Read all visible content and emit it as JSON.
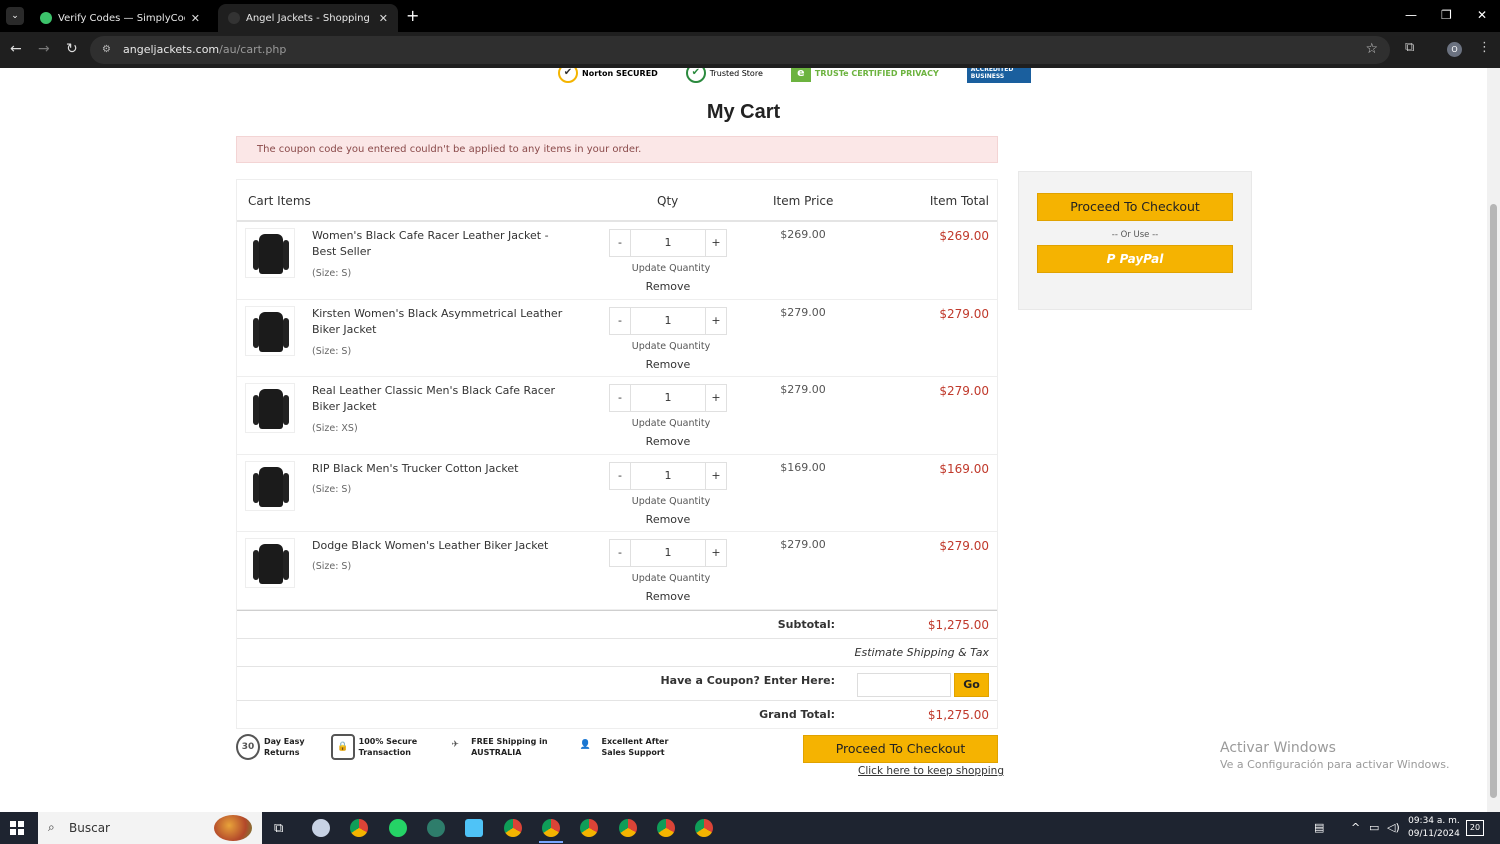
{
  "browser": {
    "tabs": [
      {
        "title": "Verify Codes — SimplyCodes",
        "close": "✕"
      },
      {
        "title": "Angel Jackets - Shopping Cart |",
        "close": "✕"
      }
    ],
    "new_tab": "+",
    "url_host": "angeljackets.com",
    "url_path": "/au/cart.php",
    "profile_initial": "O"
  },
  "badges": {
    "norton": "Norton SECURED",
    "trusted_store": "Trusted Store",
    "truste": "TRUSTe CERTIFIED PRIVACY",
    "bbb": "ACCREDITED BUSINESS"
  },
  "page": {
    "title": "My Cart",
    "alert": "The coupon code you entered couldn't be applied to any items in your order."
  },
  "cart": {
    "headers": {
      "items": "Cart Items",
      "qty": "Qty",
      "price": "Item Price",
      "total": "Item Total"
    },
    "minus": "-",
    "plus": "+",
    "update_label": "Update Quantity",
    "remove_label": "Remove",
    "items": [
      {
        "name": "Women's Black Cafe Racer Leather Jacket - Best Seller",
        "size": "(Size: S)",
        "qty": "1",
        "price": "$269.00",
        "total": "$269.00"
      },
      {
        "name": "Kirsten Women's Black Asymmetrical Leather Biker Jacket",
        "size": "(Size: S)",
        "qty": "1",
        "price": "$279.00",
        "total": "$279.00"
      },
      {
        "name": "Real Leather Classic Men's Black Cafe Racer Biker Jacket",
        "size": "(Size: XS)",
        "qty": "1",
        "price": "$279.00",
        "total": "$279.00"
      },
      {
        "name": "RIP Black Men's Trucker Cotton Jacket",
        "size": "(Size: S)",
        "qty": "1",
        "price": "$169.00",
        "total": "$169.00"
      },
      {
        "name": "Dodge Black Women's Leather Biker Jacket",
        "size": "(Size: S)",
        "qty": "1",
        "price": "$279.00",
        "total": "$279.00"
      }
    ],
    "subtotal_label": "Subtotal:",
    "subtotal": "$1,275.00",
    "estimate": "Estimate Shipping & Tax",
    "coupon_label": "Have a Coupon? Enter Here:",
    "coupon_value": "",
    "go": "Go",
    "grand_label": "Grand Total:",
    "grand_total": "$1,275.00"
  },
  "features": [
    {
      "icon": "30",
      "line1": "Day Easy",
      "line2": "Returns"
    },
    {
      "icon": "🔒",
      "line1": "100% Secure",
      "line2": "Transaction"
    },
    {
      "icon": "✈",
      "line1": "FREE Shipping in",
      "line2": "AUSTRALIA"
    },
    {
      "icon": "👤",
      "line1": "Excellent After",
      "line2": "Sales Support"
    }
  ],
  "checkout": {
    "button": "Proceed To Checkout",
    "keep_shopping": "Click here to keep shopping",
    "or_use": "-- Or Use --",
    "paypal": "PayPal"
  },
  "windows": {
    "activate_title": "Activar Windows",
    "activate_sub": "Ve a Configuración para activar Windows.",
    "search": "Buscar",
    "time": "09:34 a. m.",
    "date": "09/11/2024",
    "notifications": "20"
  },
  "colors": {
    "accent": "#f5b301",
    "price_red": "#c0392b",
    "alert_bg": "#fbe7e7"
  }
}
